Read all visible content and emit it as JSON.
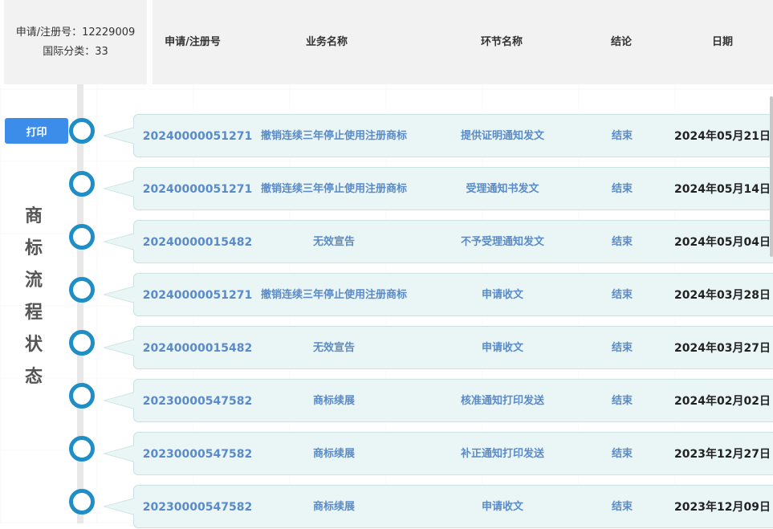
{
  "info": {
    "reg_no": "申请/注册号：12229009",
    "intl_class": "国际分类：33"
  },
  "headers": {
    "reg_no": "申请/注册号",
    "business": "业务名称",
    "step": "环节名称",
    "conclusion": "结论",
    "date": "日期"
  },
  "print_label": "打印",
  "side_title": [
    "商",
    "标",
    "流",
    "程",
    "状",
    "态"
  ],
  "rows": [
    {
      "reg_no": "20240000051271",
      "business": "撤销连续三年停止使用注册商标",
      "step": "提供证明通知发文",
      "conclusion": "结束",
      "date": "2024年05月21日"
    },
    {
      "reg_no": "20240000051271",
      "business": "撤销连续三年停止使用注册商标",
      "step": "受理通知书发文",
      "conclusion": "结束",
      "date": "2024年05月14日"
    },
    {
      "reg_no": "20240000015482",
      "business": "无效宣告",
      "step": "不予受理通知发文",
      "conclusion": "结束",
      "date": "2024年05月04日"
    },
    {
      "reg_no": "20240000051271",
      "business": "撤销连续三年停止使用注册商标",
      "step": "申请收文",
      "conclusion": "结束",
      "date": "2024年03月28日"
    },
    {
      "reg_no": "20240000015482",
      "business": "无效宣告",
      "step": "申请收文",
      "conclusion": "结束",
      "date": "2024年03月27日"
    },
    {
      "reg_no": "20230000547582",
      "business": "商标续展",
      "step": "核准通知打印发送",
      "conclusion": "结束",
      "date": "2024年02月02日"
    },
    {
      "reg_no": "20230000547582",
      "business": "商标续展",
      "step": "补正通知打印发送",
      "conclusion": "结束",
      "date": "2023年12月27日"
    },
    {
      "reg_no": "20230000547582",
      "business": "商标续展",
      "step": "申请收文",
      "conclusion": "结束",
      "date": "2023年12月09日"
    }
  ]
}
